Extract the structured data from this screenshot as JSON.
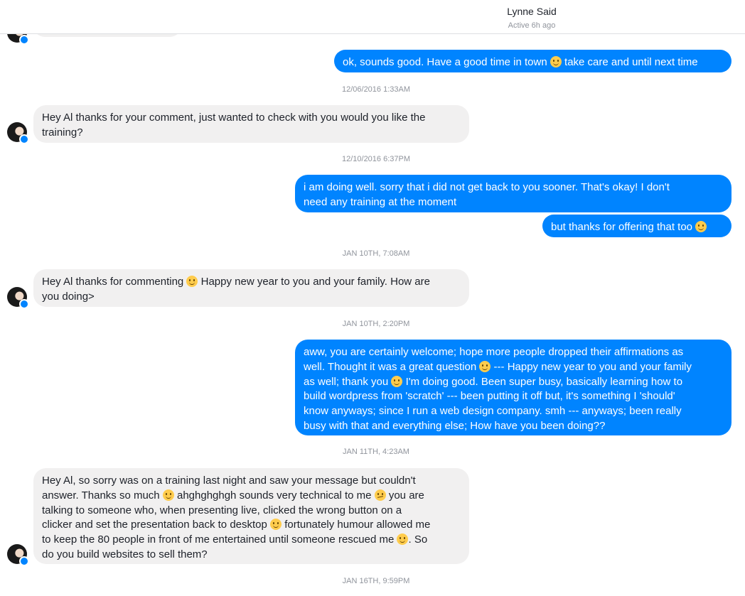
{
  "header": {
    "contact_name": "Lynne Said",
    "status": "Active 6h ago"
  },
  "messages": [
    {
      "lines": [
        "ok, sounds good. Have a good time in town [smile] take care and until next time"
      ]
    },
    {
      "lines": [
        "Hey Al thanks for your comment, just wanted to check with you would you like the",
        "training?"
      ]
    },
    {
      "lines": [
        "i am doing well. sorry that i did not get back to you sooner. That's okay! I don't",
        "need any training at the moment"
      ]
    },
    {
      "lines": [
        "but thanks for offering that too [smile]"
      ]
    },
    {
      "lines": [
        "Hey Al thanks for commenting [smile] Happy new year to you and your family. How are",
        "you doing>"
      ]
    },
    {
      "lines": [
        "aww, you are certainly welcome; hope more people dropped their affirmations as",
        "well. Thought it was a great question [smile] --- Happy new year to you and your family",
        "as well; thank you [smile] I'm doing good. Been super busy, basically learning how to",
        "build wordpress from 'scratch' --- been putting it off but, it's something I 'should'",
        "know anyways; since I run a web design company. smh --- anyways; been really",
        "busy with that and everything else; How have you been doing??"
      ]
    },
    {
      "lines": [
        "Hey Al, so sorry was on a training last night and saw your message but couldn't",
        "answer.  Thanks so much [smile] ahghghghgh sounds very technical to me [confused] you are",
        "talking to someone who, when presenting live, clicked the wrong button on a",
        "clicker and set the presentation back to desktop [smile] fortunately humour allowed me",
        "to keep the 80 people in front of me entertained until someone rescued me [smile].  So",
        "do you build websites to sell them?"
      ]
    }
  ],
  "timestamps": [
    "12/06/2016 1:33AM",
    "12/10/2016 6:37PM",
    "JAN 10TH, 7:08AM",
    "JAN 10TH, 2:20PM",
    "JAN 11TH, 4:23AM",
    "JAN 16TH, 9:59PM"
  ],
  "icons": {
    "smile": "slightly-smiling-face-emoji",
    "confused": "confused-face-emoji",
    "badge": "messenger-badge-icon"
  },
  "colors": {
    "outgoing": "#0084ff",
    "incoming": "#f1f0f0",
    "meta_text": "#90949c"
  }
}
